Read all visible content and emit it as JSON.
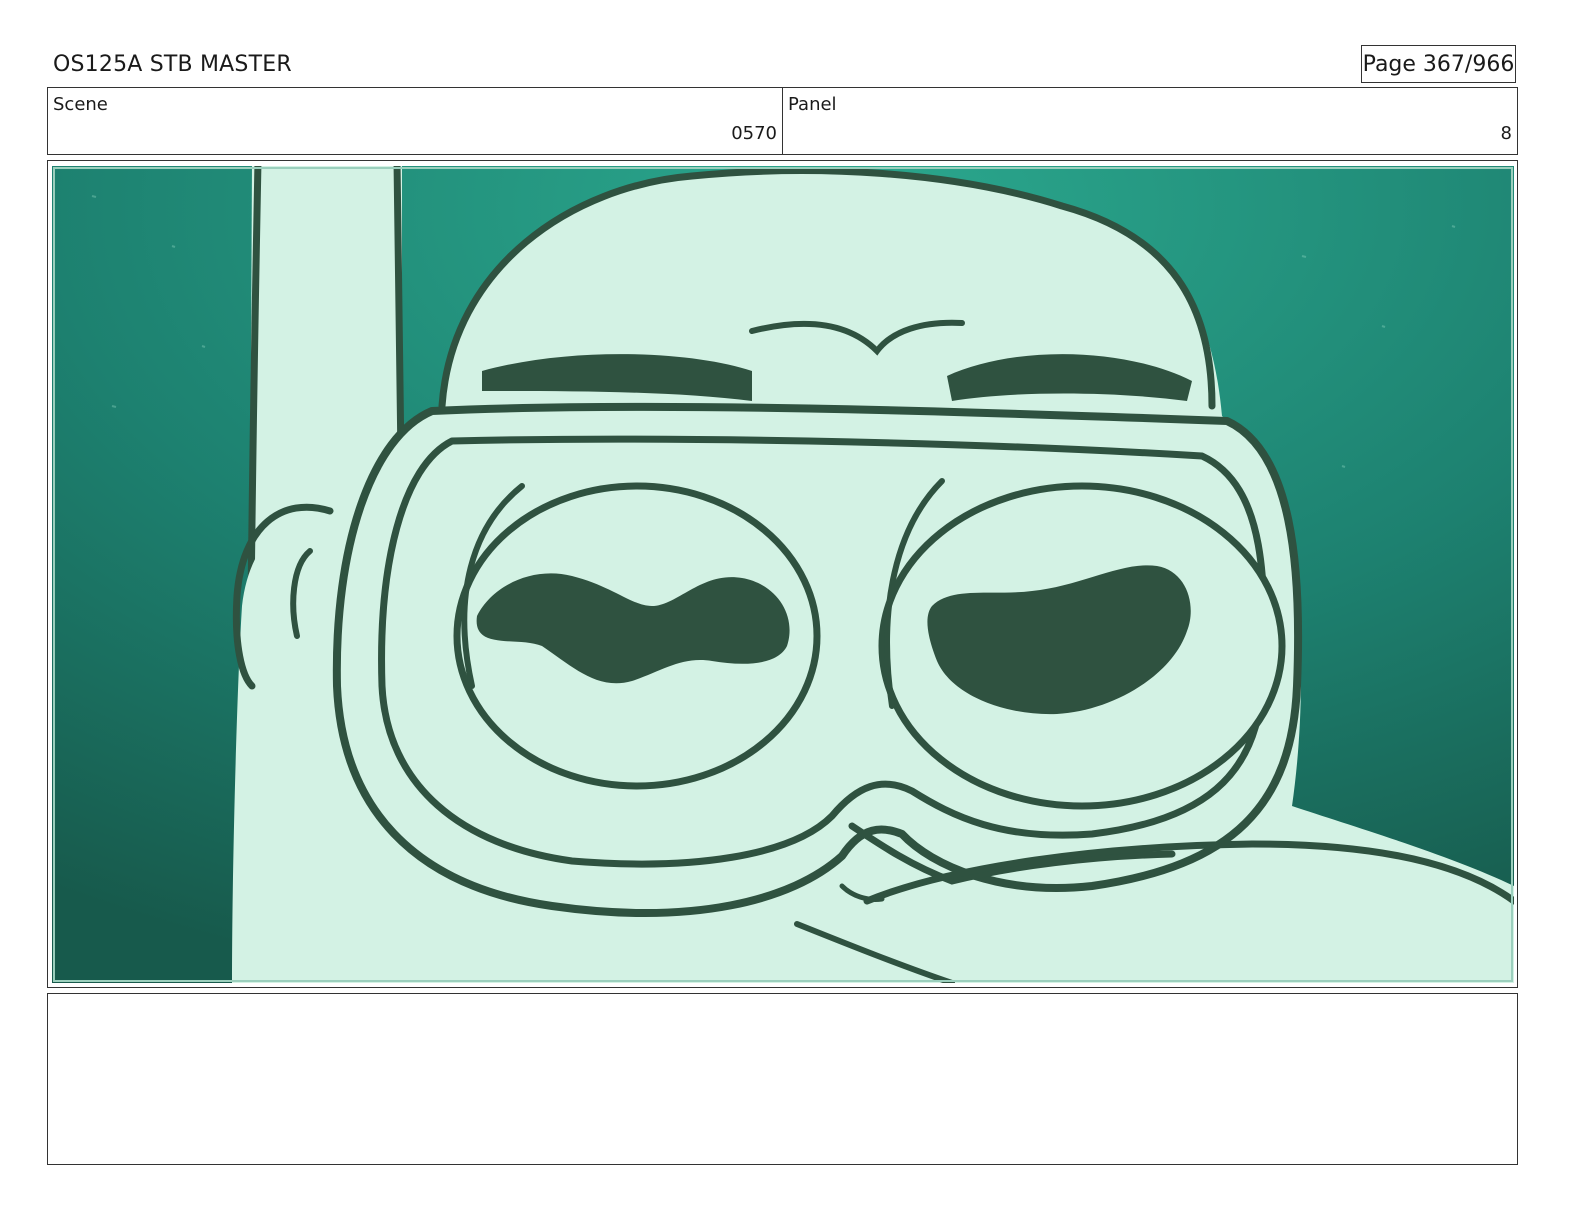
{
  "header": {
    "title": "OS125A STB MASTER",
    "page_label": "Page 367/966"
  },
  "info": {
    "scene_label": "Scene",
    "scene_value": "0570",
    "panel_label": "Panel",
    "panel_value": "8"
  },
  "frame": {
    "description_kind": "storyboard drawing",
    "colors": {
      "water_light": "#2ba88e",
      "water_dark": "#175a4c",
      "fill": "#d3f2e4",
      "line": "#2f5240"
    }
  },
  "notes": {
    "text": ""
  }
}
